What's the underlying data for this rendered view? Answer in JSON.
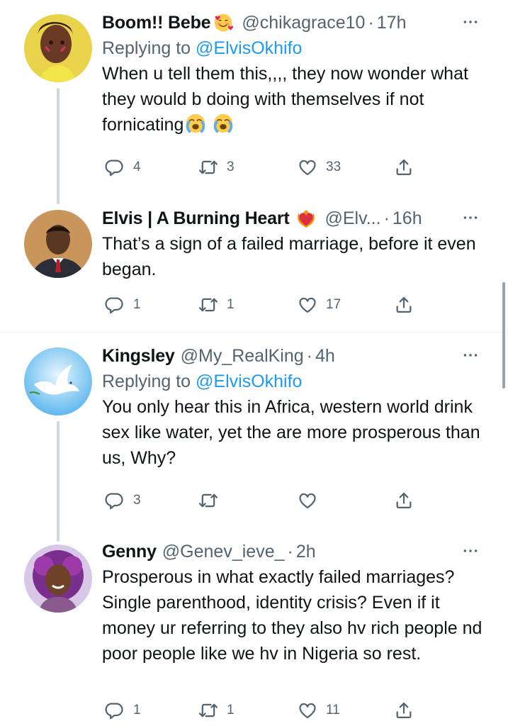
{
  "tweets": [
    {
      "name": "Boom!! Bebe",
      "name_emoji": "smiling-face-with-hearts",
      "handle": "@chikagrace10",
      "time": "17h",
      "reply_prefix": "Replying to ",
      "reply_mention": "@ElvisOkhifo",
      "body": "When u tell them this,,,, they now wonder what they would b doing with themselves if not fornicating",
      "body_emojis": [
        "loudly-crying-face",
        "loudly-crying-face"
      ],
      "replies": "4",
      "retweets": "3",
      "likes": "33"
    },
    {
      "name": "Elvis | A Burning Heart",
      "name_emoji": "heart-on-fire",
      "handle": "@Elv...",
      "time": "16h",
      "body": "That’s a sign of a failed marriage, before it even began.",
      "replies": "1",
      "retweets": "1",
      "likes": "17"
    },
    {
      "name": "Kingsley",
      "handle": "@My_RealKing",
      "time": "4h",
      "reply_prefix": "Replying to ",
      "reply_mention": "@ElvisOkhifo",
      "body": "You only hear this in Africa, western world drink sex like water, yet the are more prosperous than us, Why?",
      "replies": "3",
      "retweets": "",
      "likes": ""
    },
    {
      "name": "Genny",
      "handle": "@Genev_ieve_",
      "time": "2h",
      "body": "Prosperous in what exactly failed marriages? Single parenthood, identity crisis? Even if it money ur referring to they also hv rich people nd poor people like we hv in Nigeria so rest.",
      "replies": "1",
      "retweets": "1",
      "likes": "11"
    }
  ],
  "separator": "·",
  "colors": {
    "text": "#0f1419",
    "secondary": "#536471",
    "link": "#1d9bf0",
    "thread_line": "#cfd9de",
    "divider": "#eff3f4"
  }
}
